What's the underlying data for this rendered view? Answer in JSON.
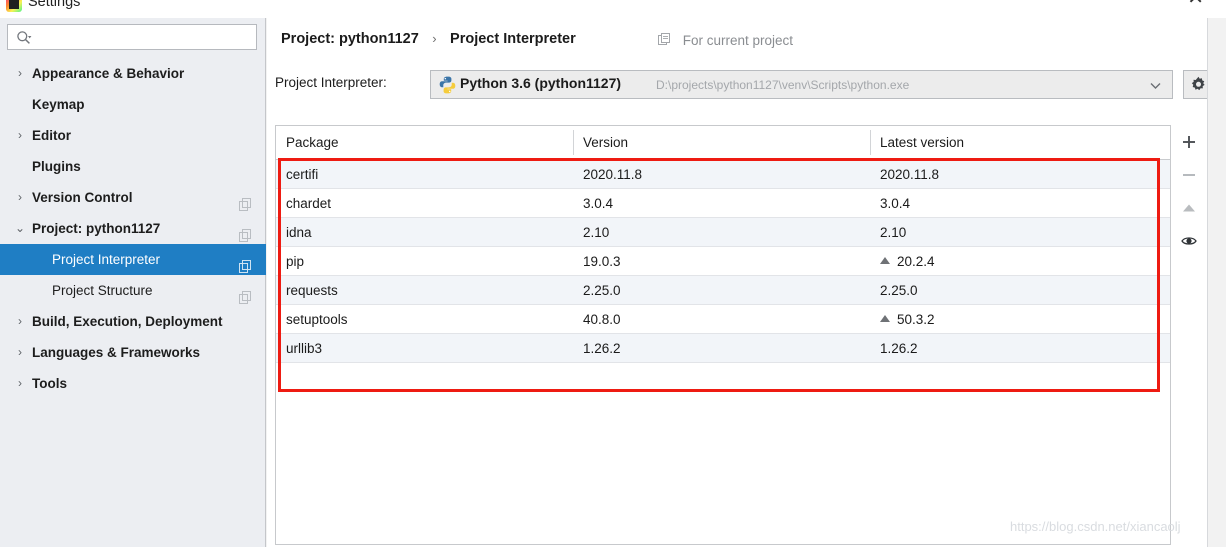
{
  "window": {
    "title": "Settings",
    "close_label": "✕",
    "app_icon": "intellij-idea-icon"
  },
  "sidebar": {
    "search": {
      "value": "",
      "placeholder": "",
      "icon": "search-icon"
    },
    "items": [
      {
        "label": "Appearance & Behavior",
        "level": 0,
        "arrow": "›",
        "expandable": true,
        "selected": false,
        "badge": false
      },
      {
        "label": "Keymap",
        "level": 0,
        "arrow": "",
        "expandable": false,
        "selected": false,
        "badge": false
      },
      {
        "label": "Editor",
        "level": 0,
        "arrow": "›",
        "expandable": true,
        "selected": false,
        "badge": false
      },
      {
        "label": "Plugins",
        "level": 0,
        "arrow": "",
        "expandable": false,
        "selected": false,
        "badge": false
      },
      {
        "label": "Version Control",
        "level": 0,
        "arrow": "›",
        "expandable": true,
        "selected": false,
        "badge": true
      },
      {
        "label": "Project: python1127",
        "level": 0,
        "arrow": "⌄",
        "expandable": true,
        "selected": false,
        "badge": true
      },
      {
        "label": "Project Interpreter",
        "level": 1,
        "arrow": "",
        "expandable": false,
        "selected": true,
        "badge": true
      },
      {
        "label": "Project Structure",
        "level": 1,
        "arrow": "",
        "expandable": false,
        "selected": false,
        "badge": true
      },
      {
        "label": "Build, Execution, Deployment",
        "level": 0,
        "arrow": "›",
        "expandable": true,
        "selected": false,
        "badge": false
      },
      {
        "label": "Languages & Frameworks",
        "level": 0,
        "arrow": "›",
        "expandable": true,
        "selected": false,
        "badge": false
      },
      {
        "label": "Tools",
        "level": 0,
        "arrow": "›",
        "expandable": true,
        "selected": false,
        "badge": false
      }
    ]
  },
  "header": {
    "breadcrumb_root": "Project: python1127",
    "breadcrumb_separator": "›",
    "breadcrumb_leaf": "Project Interpreter",
    "scope_hint": "For current project",
    "scope_icon": "copy-icon"
  },
  "interpreter": {
    "label": "Project Interpreter:",
    "name": "Python 3.6 (python1127)",
    "path": "D:\\projects\\python1127\\venv\\Scripts\\python.exe",
    "icon": "python-icon",
    "chevron_icon": "chevron-down-icon",
    "settings_icon": "gear-icon"
  },
  "packages_table": {
    "columns": [
      "Package",
      "Version",
      "Latest version"
    ],
    "rows": [
      {
        "package": "certifi",
        "version": "2020.11.8",
        "latest": "2020.11.8",
        "upgradable": false
      },
      {
        "package": "chardet",
        "version": "3.0.4",
        "latest": "3.0.4",
        "upgradable": false
      },
      {
        "package": "idna",
        "version": "2.10",
        "latest": "2.10",
        "upgradable": false
      },
      {
        "package": "pip",
        "version": "19.0.3",
        "latest": "20.2.4",
        "upgradable": true
      },
      {
        "package": "requests",
        "version": "2.25.0",
        "latest": "2.25.0",
        "upgradable": false
      },
      {
        "package": "setuptools",
        "version": "40.8.0",
        "latest": "50.3.2",
        "upgradable": true
      },
      {
        "package": "urllib3",
        "version": "1.26.2",
        "latest": "1.26.2",
        "upgradable": false
      }
    ]
  },
  "package_toolbar": {
    "buttons": [
      {
        "name": "add-package-button",
        "glyph": "+",
        "icon": "plus-icon"
      },
      {
        "name": "remove-package-button",
        "glyph": "−",
        "icon": "minus-icon"
      },
      {
        "name": "upgrade-package-button",
        "glyph": "▲",
        "icon": "triangle-up-icon"
      },
      {
        "name": "show-early-releases-button",
        "glyph": "◉",
        "icon": "eye-icon"
      }
    ]
  },
  "annotation": {
    "highlight_color": "#ee1b12"
  },
  "watermark": {
    "text": "https://blog.csdn.net/xiancaolj"
  }
}
